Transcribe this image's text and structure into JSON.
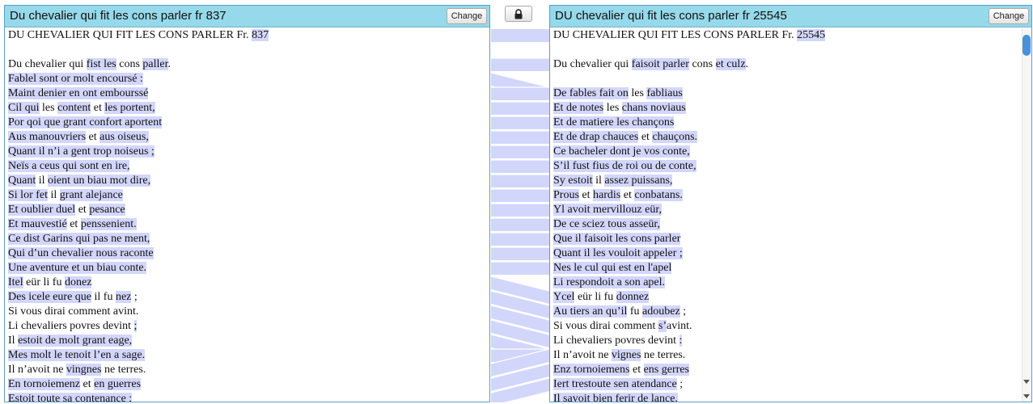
{
  "left": {
    "title": "Du chevalier qui fit les cons parler fr 837",
    "change_label": "Change",
    "lines": [
      [
        [
          "DU CHEVALIER QUI FIT LES CONS PARLER Fr. ",
          0
        ],
        [
          "837",
          1
        ]
      ],
      [],
      [
        [
          "Du chevalier qui ",
          0
        ],
        [
          "fist les",
          1
        ],
        [
          " cons ",
          0
        ],
        [
          "paller",
          1
        ],
        [
          ".",
          0
        ]
      ],
      [
        [
          "Fablel sont or molt encoursé :",
          1
        ]
      ],
      [
        [
          "Maint denier en ont embourssé",
          1
        ]
      ],
      [
        [
          "Cil qui",
          1
        ],
        [
          " les ",
          0
        ],
        [
          "content",
          1
        ],
        [
          " et ",
          0
        ],
        [
          "les portent,",
          1
        ]
      ],
      [
        [
          "Por qoi que grant confort aportent",
          1
        ]
      ],
      [
        [
          "Aus manouvriers",
          1
        ],
        [
          " et ",
          0
        ],
        [
          "aus oiseus,",
          1
        ]
      ],
      [
        [
          "Quant il n’i a gent trop noiseus ;",
          1
        ]
      ],
      [
        [
          "Neïs a ceus qui sont en ire,",
          1
        ]
      ],
      [
        [
          "Quant",
          1
        ],
        [
          " il ",
          0
        ],
        [
          "oient un biau mot dire,",
          1
        ]
      ],
      [
        [
          "Si lor fet",
          1
        ],
        [
          " il ",
          0
        ],
        [
          "grant alejance",
          1
        ]
      ],
      [
        [
          "Et oublier duel",
          1
        ],
        [
          " et ",
          0
        ],
        [
          "pesance",
          1
        ]
      ],
      [
        [
          "Et mauvestié",
          1
        ],
        [
          " et ",
          0
        ],
        [
          "penssenient.",
          1
        ]
      ],
      [
        [
          "Ce dist Garins qui pas ne ment,",
          1
        ]
      ],
      [
        [
          "Qui d’un chevalier nous raconte",
          1
        ]
      ],
      [
        [
          "Une aventure et un biau conte.",
          1
        ]
      ],
      [
        [
          "Itel",
          1
        ],
        [
          " eür li fu ",
          0
        ],
        [
          "donez",
          1
        ]
      ],
      [
        [
          "Des icele eure que",
          1
        ],
        [
          " il fu ",
          0
        ],
        [
          "nez",
          1
        ],
        [
          " ;",
          0
        ]
      ],
      [
        [
          "Si vous dirai comment avint.",
          0
        ]
      ],
      [
        [
          "Li chevaliers povres devint ",
          0
        ],
        [
          ";",
          1
        ]
      ],
      [
        [
          "Il ",
          0
        ],
        [
          "estoit de molt grant eage,",
          1
        ]
      ],
      [
        [
          "Mes molt le tenoit l’en a sage.",
          1
        ]
      ],
      [
        [
          "Il n’avoit ne ",
          0
        ],
        [
          "vingnes",
          1
        ],
        [
          " ne terres.",
          0
        ]
      ],
      [
        [
          "En tornoiemenz",
          1
        ],
        [
          " et ",
          0
        ],
        [
          "en guerres",
          1
        ]
      ],
      [
        [
          "Estoit toute sa contenance ;",
          1
        ]
      ]
    ]
  },
  "right": {
    "title": "DU chevalier qui fit les cons parler fr 25545",
    "change_label": "Change",
    "lines": [
      [
        [
          "DU CHEVALIER QUI FIT LES CONS PARLER Fr. ",
          0
        ],
        [
          "25545",
          1
        ]
      ],
      [],
      [
        [
          "Du chevalier qui ",
          0
        ],
        [
          "faisoit parler",
          1
        ],
        [
          " cons ",
          0
        ],
        [
          "et culz",
          1
        ],
        [
          ".",
          0
        ]
      ],
      [],
      [
        [
          "De fables fait on",
          1
        ],
        [
          " les ",
          0
        ],
        [
          "fabliaus",
          1
        ]
      ],
      [
        [
          "Et de notes",
          1
        ],
        [
          " les ",
          0
        ],
        [
          "chans noviaus",
          1
        ]
      ],
      [
        [
          "Et de matiere les chançons",
          1
        ]
      ],
      [
        [
          "Et de drap chauces",
          1
        ],
        [
          " et ",
          0
        ],
        [
          "chauçons.",
          1
        ]
      ],
      [
        [
          "Ce bacheler dont je vos conte,",
          1
        ]
      ],
      [
        [
          "S’il fust fius de roi ou de conte,",
          1
        ]
      ],
      [
        [
          "Sy estoit",
          1
        ],
        [
          " il ",
          0
        ],
        [
          "assez puissans,",
          1
        ]
      ],
      [
        [
          "Prous",
          1
        ],
        [
          " et ",
          0
        ],
        [
          "hardis",
          1
        ],
        [
          " et ",
          0
        ],
        [
          "conbatans.",
          1
        ]
      ],
      [
        [
          "Yl avoit mervillouz eür,",
          1
        ]
      ],
      [
        [
          "De ce sciez tous asseür,",
          1
        ]
      ],
      [
        [
          "Que il faisoit les cons parler",
          1
        ]
      ],
      [
        [
          "Quant il les vouloit appeler ;",
          1
        ]
      ],
      [
        [
          "Nes le cul qui est en l'apel",
          1
        ]
      ],
      [
        [
          "Li respondoit a son apel.",
          1
        ]
      ],
      [
        [
          "Ycel",
          1
        ],
        [
          " eür li fu ",
          0
        ],
        [
          "donnez",
          1
        ]
      ],
      [
        [
          "Au tiers an qu’il",
          1
        ],
        [
          " fu ",
          0
        ],
        [
          "adoubez",
          1
        ],
        [
          " ;",
          0
        ]
      ],
      [
        [
          "Si vous dirai comment ",
          0
        ],
        [
          "s’",
          1
        ],
        [
          "avint.",
          0
        ]
      ],
      [
        [
          "Li chevaliers povres devint ",
          0
        ],
        [
          ":",
          1
        ]
      ],
      [
        [
          "Il n’avoit ne ",
          0
        ],
        [
          "vignes",
          1
        ],
        [
          " ne terres.",
          0
        ]
      ],
      [
        [
          "Enz tornoiemens",
          1
        ],
        [
          " et ",
          0
        ],
        [
          "ens gerres",
          1
        ]
      ],
      [
        [
          "Iert trestoute sen atendance",
          1
        ],
        [
          " ;",
          0
        ]
      ],
      [
        [
          "Il savoit bien ferir de lance.",
          1
        ]
      ]
    ]
  },
  "connector": {
    "links": [
      [
        0,
        0
      ],
      [
        2,
        2
      ],
      [
        3,
        4
      ],
      [
        4,
        4
      ],
      [
        5,
        5
      ],
      [
        6,
        6
      ],
      [
        7,
        7
      ],
      [
        8,
        8
      ],
      [
        9,
        9
      ],
      [
        10,
        10
      ],
      [
        11,
        11
      ],
      [
        12,
        12
      ],
      [
        13,
        13
      ],
      [
        14,
        14
      ],
      [
        15,
        15
      ],
      [
        16,
        16
      ],
      [
        17,
        18
      ],
      [
        18,
        19
      ],
      [
        19,
        20
      ],
      [
        20,
        21
      ],
      [
        21,
        22
      ],
      [
        22,
        22
      ],
      [
        23,
        22
      ],
      [
        24,
        23
      ],
      [
        25,
        24
      ]
    ],
    "color": "#d3d6fb",
    "line_color": "#ffffff"
  },
  "lock_icon": "lock-icon"
}
